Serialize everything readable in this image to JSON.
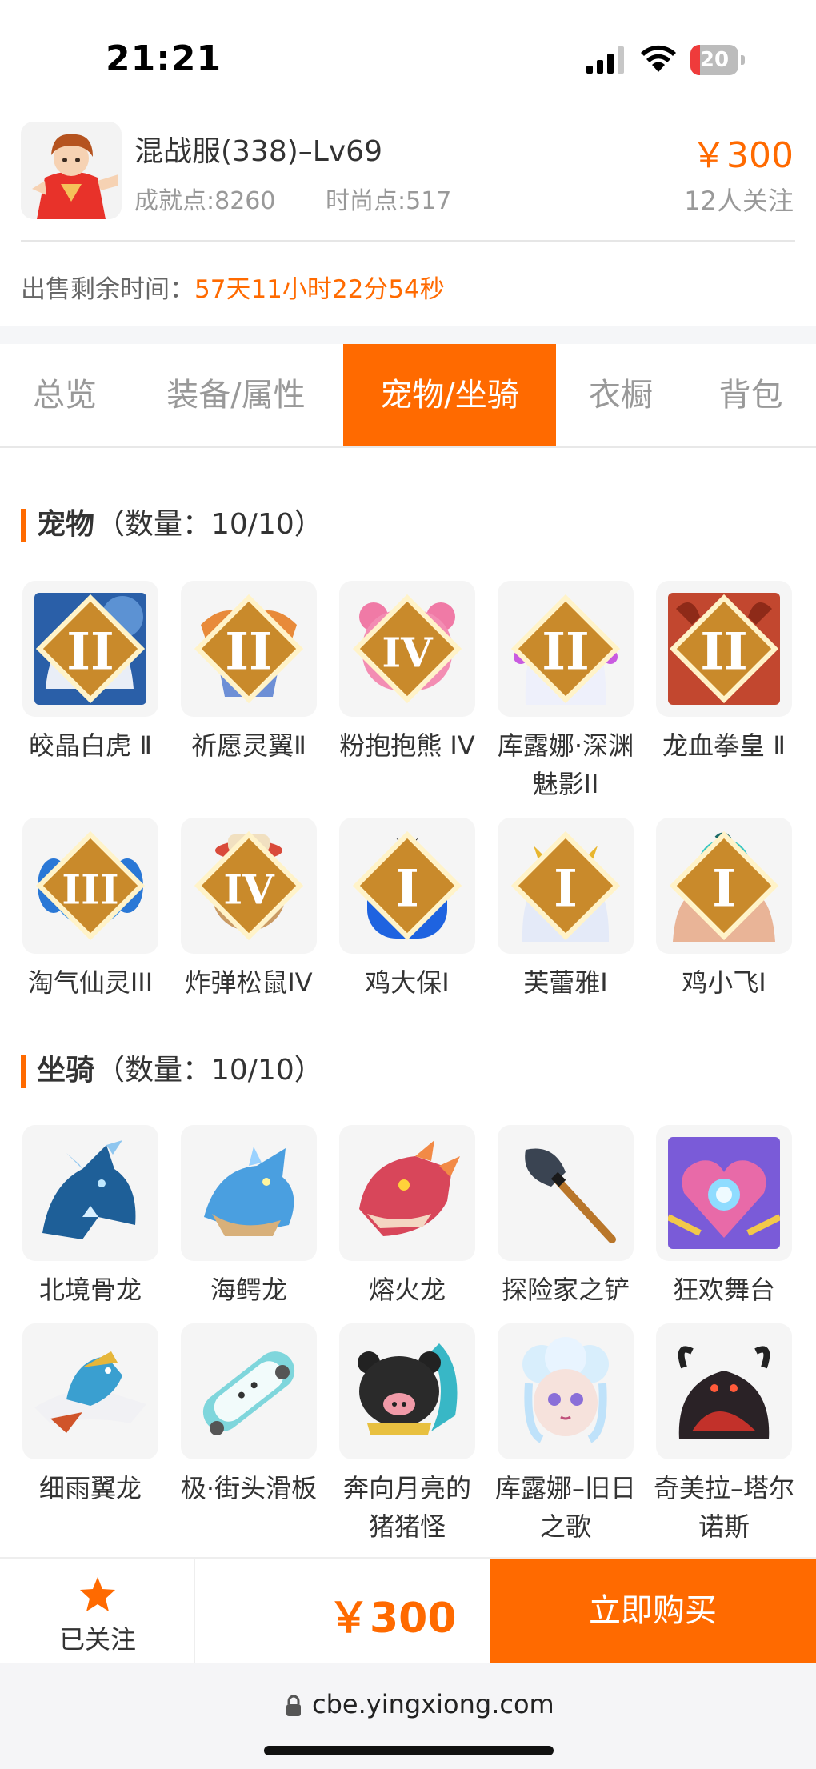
{
  "status_bar": {
    "time": "21:21",
    "battery": "20",
    "battery_level": 0.2
  },
  "header": {
    "title": "混战服(338)–Lv69",
    "achievement": "成就点:8260",
    "fashion": "时尚点:517",
    "price": "￥300",
    "followers": "12人关注",
    "remaining_label": "出售剩余时间：",
    "remaining_value": "57天11小时22分54秒"
  },
  "tabs": [
    {
      "label": "总览",
      "active": false
    },
    {
      "label": "装备/属性",
      "active": false
    },
    {
      "label": "宠物/坐骑",
      "active": true
    },
    {
      "label": "衣橱",
      "active": false
    },
    {
      "label": "背包",
      "active": false
    }
  ],
  "pets": {
    "title": "宠物",
    "count": "（数量：10/10）",
    "items": [
      {
        "name": "皎晶白虎 Ⅱ",
        "tier": "II",
        "icon": "white-tiger-icon"
      },
      {
        "name": "祈愿灵翼Ⅱ",
        "tier": "II",
        "icon": "phoenix-bird-icon"
      },
      {
        "name": "粉抱抱熊 IV",
        "tier": "IV",
        "icon": "pink-bear-icon"
      },
      {
        "name": "库露娜·深渊魅影II",
        "tier": "II",
        "icon": "kuluna-girl-icon"
      },
      {
        "name": "龙血拳皇 Ⅱ",
        "tier": "II",
        "icon": "dragon-fist-king-icon"
      },
      {
        "name": "淘气仙灵III",
        "tier": "III",
        "icon": "blue-puppy-icon"
      },
      {
        "name": "炸弹松鼠IV",
        "tier": "IV",
        "icon": "bomb-squirrel-icon"
      },
      {
        "name": "鸡大保I",
        "tier": "I",
        "icon": "blue-chicken-sunglasses-icon"
      },
      {
        "name": "芙蕾雅I",
        "tier": "I",
        "icon": "freya-girl-icon"
      },
      {
        "name": "鸡小飞I",
        "tier": "I",
        "icon": "teal-chick-muscle-icon"
      }
    ]
  },
  "mounts": {
    "title": "坐骑",
    "count": "（数量：10/10）",
    "items": [
      {
        "name": "北境骨龙",
        "icon": "bone-dragon-icon"
      },
      {
        "name": "海鳄龙",
        "icon": "sea-croc-dragon-icon"
      },
      {
        "name": "熔火龙",
        "icon": "fire-dragon-icon"
      },
      {
        "name": "探险家之铲",
        "icon": "shovel-icon"
      },
      {
        "name": "狂欢舞台",
        "icon": "dance-stage-icon"
      },
      {
        "name": "细雨翼龙",
        "icon": "rain-pterodactyl-icon"
      },
      {
        "name": "极·街头滑板",
        "icon": "skateboard-icon"
      },
      {
        "name": "奔向月亮的猪猪怪",
        "icon": "moon-pig-icon"
      },
      {
        "name": "库露娜–旧日之歌",
        "icon": "kuluna-song-icon"
      },
      {
        "name": "奇美拉–塔尔诺斯",
        "icon": "chimera-icon"
      }
    ]
  },
  "bottom": {
    "follow_label": "已关注",
    "price": "￥300",
    "buy_label": "立即购买"
  },
  "browser": {
    "url": "cbe.yingxiong.com"
  },
  "colors": {
    "accent": "#ff6a00",
    "text": "#333333",
    "muted": "#999999"
  }
}
